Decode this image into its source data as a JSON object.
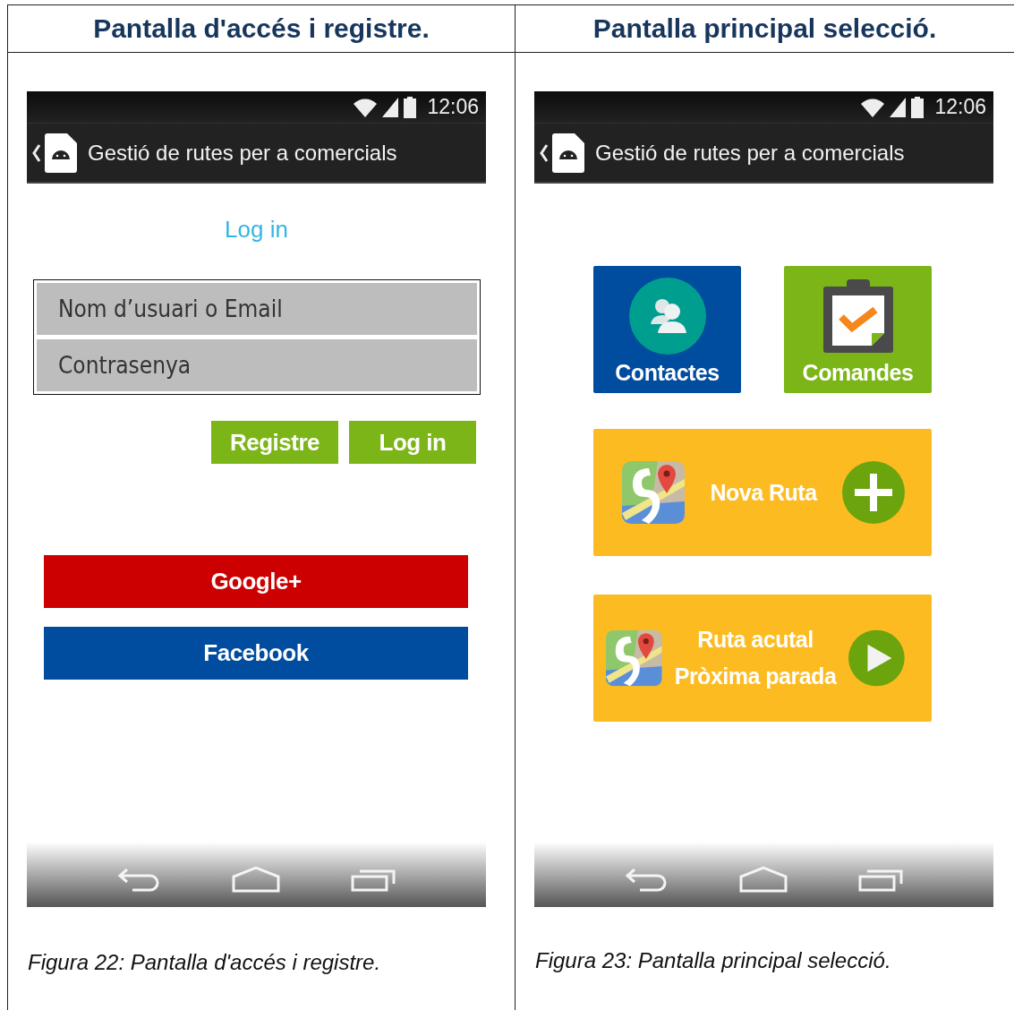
{
  "panels": [
    {
      "heading": "Pantalla d'accés i registre.",
      "caption": "Figura 22: Pantalla d'accés i registre.",
      "phone": {
        "time": "12:06",
        "app_title": "Gestió de rutes per a comercials",
        "screen": {
          "kind": "login",
          "title": "Log in",
          "fields": [
            {
              "placeholder": "Nom d’usuari o Email"
            },
            {
              "placeholder": "Contrasenya"
            }
          ],
          "buttons": [
            "Registre",
            "Log in"
          ],
          "social_buttons": [
            {
              "label": "Google+",
              "color": "#cc0000"
            },
            {
              "label": "Facebook",
              "color": "#004c9e"
            }
          ]
        }
      }
    },
    {
      "heading": "Pantalla principal selecció.",
      "caption": "Figura 23: Pantalla principal selecció.",
      "phone": {
        "time": "12:06",
        "app_title": "Gestió de rutes per a comercials",
        "screen": {
          "kind": "menu",
          "tiles": [
            {
              "label": "Contactes",
              "color": "#004c9e",
              "kind": "contacts"
            },
            {
              "label": "Comandes",
              "color": "#7cb518",
              "kind": "orders"
            }
          ],
          "route_buttons": [
            {
              "lines": [
                "Nova Ruta"
              ],
              "kind": "add"
            },
            {
              "lines": [
                "Ruta acutal",
                "Pròxima parada"
              ],
              "kind": "play"
            }
          ]
        }
      }
    }
  ]
}
